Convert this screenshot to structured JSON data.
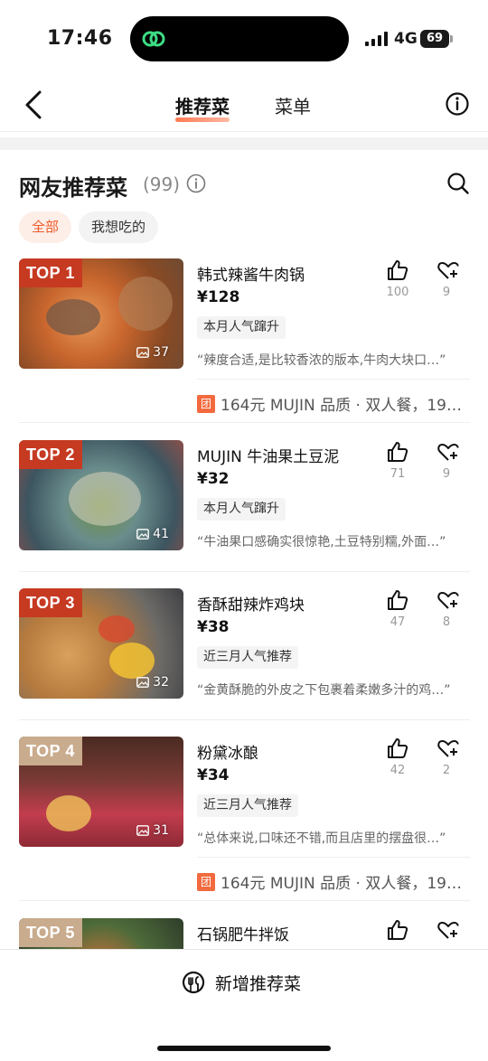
{
  "status_bar": {
    "time": "17:46",
    "network": "4G",
    "battery": "69"
  },
  "nav": {
    "tab_recommend": "推荐菜",
    "tab_menu": "菜单"
  },
  "section": {
    "title": "网友推荐菜",
    "count": "(99)"
  },
  "filters": [
    {
      "label": "全部",
      "active": true
    },
    {
      "label": "我想吃的",
      "active": false
    }
  ],
  "dishes": [
    {
      "rank": "TOP 1",
      "name": "韩式辣酱牛肉锅",
      "price": "¥128",
      "tag": "本月人气蹿升",
      "review": "“辣度合适,是比较香浓的版本,牛肉大块口…”",
      "photos": "37",
      "likes": "100",
      "favs": "9",
      "deal": "164元 MUJIN 品质 · 双人餐，19…"
    },
    {
      "rank": "TOP 2",
      "name": "MUJIN 牛油果土豆泥",
      "price": "¥32",
      "tag": "本月人气蹿升",
      "review": "“牛油果口感确实很惊艳,土豆特别糯,外面…”",
      "photos": "41",
      "likes": "71",
      "favs": "9"
    },
    {
      "rank": "TOP 3",
      "name": "香酥甜辣炸鸡块",
      "price": "¥38",
      "tag": "近三月人气推荐",
      "review": "“金黄酥脆的外皮之下包裹着柔嫩多汁的鸡…”",
      "photos": "32",
      "likes": "47",
      "favs": "8"
    },
    {
      "rank": "TOP 4",
      "name": "粉黛冰酿",
      "price": "¥34",
      "tag": "近三月人气推荐",
      "review": "“总体来说,口味还不错,而且店里的摆盘很…”",
      "photos": "31",
      "likes": "42",
      "favs": "2",
      "deal": "164元 MUJIN 品质 · 双人餐，19…"
    },
    {
      "rank": "TOP 5",
      "name": "石锅肥牛拌饭"
    }
  ],
  "deal_badge": "团",
  "bottom": {
    "add_label": "新增推荐菜"
  },
  "colors": {
    "accent": "#f05a2a",
    "rank_red": "#c63a22",
    "rank_tan": "#c9ab8d",
    "island_icon": "#3ddc84"
  },
  "icons": [
    "back-icon",
    "info-icon",
    "search-icon",
    "thumbs-up-icon",
    "heart-plus-icon",
    "photo-icon",
    "add-dish-icon"
  ]
}
